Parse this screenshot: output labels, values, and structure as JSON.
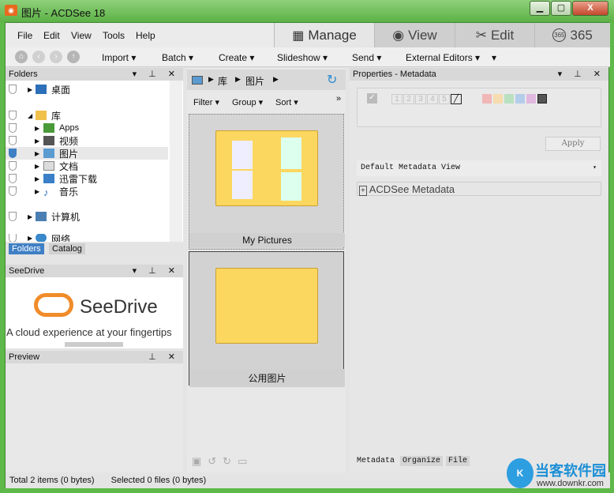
{
  "window": {
    "title": "图片 - ACDSee 18",
    "controls": [
      "minimize",
      "maximize",
      "close"
    ]
  },
  "menu": [
    "File",
    "Edit",
    "View",
    "Tools",
    "Help"
  ],
  "modes": [
    {
      "label": "Manage",
      "icon": "grid-icon",
      "active": true
    },
    {
      "label": "View",
      "icon": "eye-icon"
    },
    {
      "label": "Edit",
      "icon": "edit-tools-icon"
    },
    {
      "label": "365",
      "icon": "365-icon"
    }
  ],
  "toolbar": {
    "nav": [
      "home",
      "back",
      "forward",
      "up"
    ],
    "items": [
      "Import ▾",
      "Batch ▾",
      "Create ▾",
      "Slideshow ▾",
      "Send ▾",
      "External Editors ▾"
    ]
  },
  "folders": {
    "title": "Folders",
    "items": [
      {
        "label": "桌面",
        "level": 0
      },
      {
        "label": "库",
        "level": 0,
        "expanded": true
      },
      {
        "label": "Apps",
        "level": 1
      },
      {
        "label": "视频",
        "level": 1
      },
      {
        "label": "图片",
        "level": 1,
        "selected": true
      },
      {
        "label": "文档",
        "level": 1
      },
      {
        "label": "迅雷下载",
        "level": 1
      },
      {
        "label": "音乐",
        "level": 1
      },
      {
        "label": "计算机",
        "level": 0
      },
      {
        "label": "网络",
        "level": 0
      }
    ],
    "tabs": [
      "Folders",
      "Catalog"
    ]
  },
  "seedrive": {
    "title": "SeeDrive",
    "brand": "SeeDrive",
    "tagline": "A cloud experience at your fingertips"
  },
  "preview": {
    "title": "Preview"
  },
  "browser": {
    "breadcrumb": [
      "库",
      "图片"
    ],
    "filters": [
      "Filter ▾",
      "Group ▾",
      "Sort ▾"
    ],
    "items": [
      {
        "label": "My Pictures"
      },
      {
        "label": "公用图片"
      }
    ]
  },
  "properties": {
    "title": "Properties - Metadata",
    "ratings": [
      "1",
      "2",
      "3",
      "4",
      "5"
    ],
    "labels_colors": [
      "#f1b6b6",
      "#f6dcae",
      "#b9e0bf",
      "#b4cdea",
      "#e0b8e0",
      "#555555"
    ],
    "apply": "Apply",
    "view_select": "Default Metadata View",
    "section": "ACDSee Metadata",
    "tabs": [
      "Metadata",
      "Organize",
      "File"
    ]
  },
  "status": {
    "total": "Total 2 items  (0 bytes)",
    "selected": "Selected 0 files (0 bytes)"
  },
  "watermark": {
    "name": "当客软件园",
    "url": "www.downkr.com"
  }
}
